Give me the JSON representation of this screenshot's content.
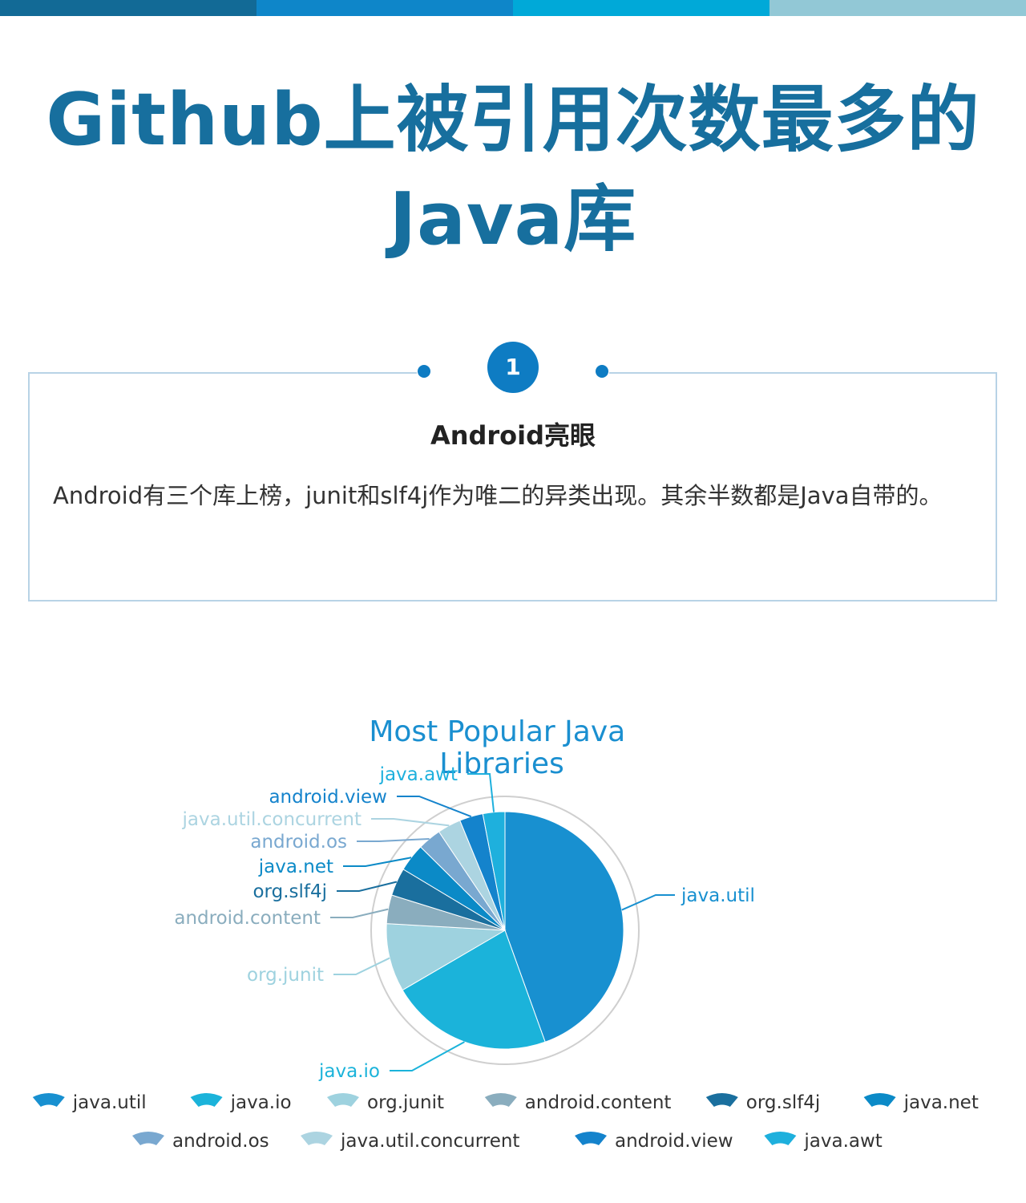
{
  "colors": {
    "bar": [
      "#126a96",
      "#0e86c9",
      "#00a9d8",
      "#92c8d6"
    ],
    "accent": "#0e7cc3",
    "title": "#176f9e"
  },
  "page": {
    "title": "Github上被引用次数最多的Java库",
    "badge": "1",
    "card_title": "Android亮眼",
    "card_body": "Android有三个库上榜，junit和slf4j作为唯二的异类出现。其余半数都是Java自带的。"
  },
  "chart_data": {
    "type": "pie",
    "title": "Most Popular Java Libraries",
    "legend": "bottom",
    "series": [
      {
        "name": "java.util",
        "value": 44.5,
        "color": "#1890d0"
      },
      {
        "name": "java.io",
        "value": 22.1,
        "color": "#1bb3da"
      },
      {
        "name": "org.junit",
        "value": 9.3,
        "color": "#9ed2df"
      },
      {
        "name": "android.content",
        "value": 3.9,
        "color": "#8aadbe"
      },
      {
        "name": "org.slf4j",
        "value": 3.8,
        "color": "#1a6f9e"
      },
      {
        "name": "java.net",
        "value": 3.8,
        "color": "#0b8ac7"
      },
      {
        "name": "android.os",
        "value": 3.2,
        "color": "#79a8d0"
      },
      {
        "name": "java.util.concurrent",
        "value": 3.2,
        "color": "#acd4e1"
      },
      {
        "name": "android.view",
        "value": 3.2,
        "color": "#1483cc"
      },
      {
        "name": "java.awt",
        "value": 3.0,
        "color": "#1eb0dd"
      }
    ]
  }
}
